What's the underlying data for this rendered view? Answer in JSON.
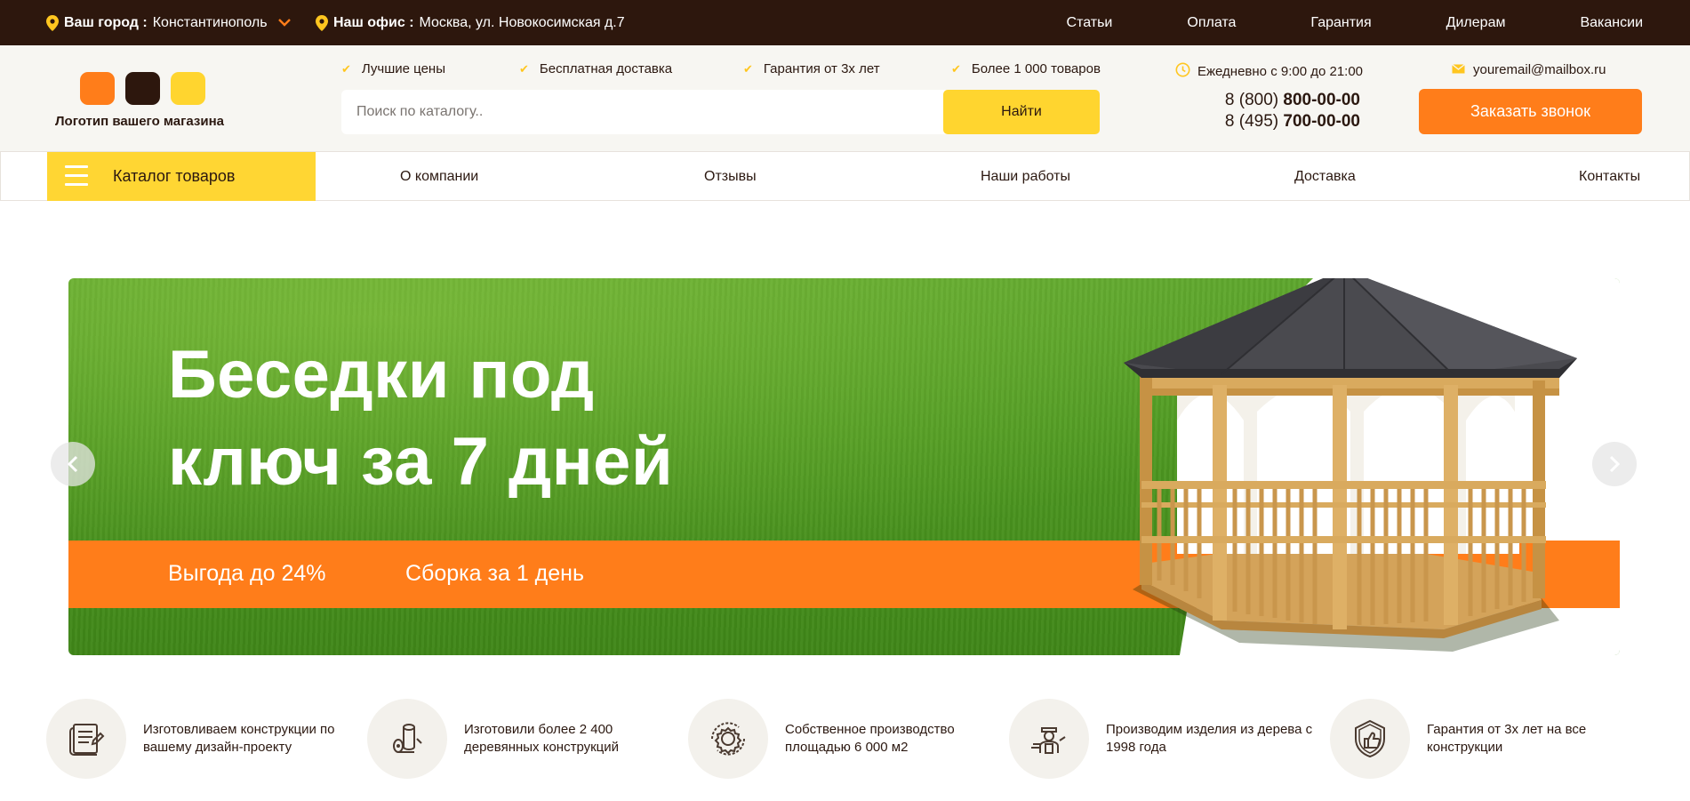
{
  "colors": {
    "brown": "#2d170d",
    "orange": "#ff7d1a",
    "yellow": "#ffd52f",
    "grass": "#4f9a22"
  },
  "topbar": {
    "city_label": "Ваш город :",
    "city_value": "Константинополь",
    "office_label": "Наш офис :",
    "office_value": "Москва, ул. Новокосимская д.7",
    "nav": [
      "Статьи",
      "Оплата",
      "Гарантия",
      "Дилерам",
      "Вакансии"
    ]
  },
  "header": {
    "logo_text": "Логотип вашего магазина",
    "perks": [
      "Лучшие цены",
      "Бесплатная доставка",
      "Гарантия от 3х лет",
      "Более 1 000 товаров"
    ],
    "search": {
      "placeholder": "Поиск по каталогу..",
      "button": "Найти"
    },
    "hours": "Ежедневно с 9:00 до 21:00",
    "phones": [
      {
        "prefix": "8 (800) ",
        "number": "800-00-00"
      },
      {
        "prefix": "8 (495) ",
        "number": "700-00-00"
      }
    ],
    "email": "youremail@mailbox.ru",
    "callback_button": "Заказать звонок"
  },
  "mainnav": {
    "catalog": "Каталог товаров",
    "links": [
      "О компании",
      "Отзывы",
      "Наши работы",
      "Доставка",
      "Контакты"
    ]
  },
  "hero": {
    "title_line1": "Беседки под",
    "title_line2": "ключ за 7 дней",
    "benefit1": "Выгода до 24%",
    "benefit2": "Сборка за 1 день"
  },
  "features": [
    {
      "icon": "blueprint-icon",
      "text": "Изготовливаем конструкции по вашему дизайн-проекту"
    },
    {
      "icon": "logs-icon",
      "text": "Изготовили более 2 400 деревянных конструкций"
    },
    {
      "icon": "gear-icon",
      "text": "Собственное производство площадью 6 000 м2"
    },
    {
      "icon": "carpenter-icon",
      "text": "Производим изделия из дерева с 1998 года"
    },
    {
      "icon": "shield-thumb-icon",
      "text": "Гарантия от 3х лет на все конструкции"
    }
  ]
}
